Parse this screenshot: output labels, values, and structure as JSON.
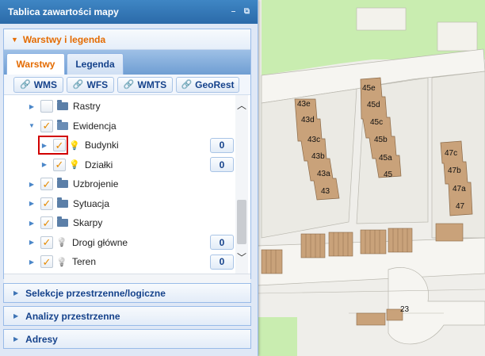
{
  "panel": {
    "title": "Tablica zawartości mapy",
    "tools": {
      "minimize": "–",
      "popout": "⧉"
    }
  },
  "layers_section": {
    "title": "Warstwy i legenda",
    "tabs": [
      {
        "label": "Warstwy",
        "active": true
      },
      {
        "label": "Legenda",
        "active": false
      }
    ],
    "services": [
      "WMS",
      "WFS",
      "WMTS",
      "GeoRest"
    ]
  },
  "tree": [
    {
      "label": "Rastry",
      "checked": false,
      "icon": "folder-icon",
      "expanded": false,
      "level": 0,
      "count": null
    },
    {
      "label": "Ewidencja",
      "checked": true,
      "icon": "folder-open-icon",
      "expanded": true,
      "level": 0,
      "count": null
    },
    {
      "label": "Budynki",
      "checked": true,
      "icon": "lightbulb-icon",
      "expanded": false,
      "level": 1,
      "count": "0",
      "highlighted": true
    },
    {
      "label": "Działki",
      "checked": true,
      "icon": "lightbulb-icon",
      "expanded": false,
      "level": 1,
      "count": "0"
    },
    {
      "label": "Uzbrojenie",
      "checked": true,
      "icon": "folder-icon",
      "expanded": false,
      "level": 0,
      "count": null
    },
    {
      "label": "Sytuacja",
      "checked": true,
      "icon": "folder-icon",
      "expanded": false,
      "level": 0,
      "count": null
    },
    {
      "label": "Skarpy",
      "checked": true,
      "icon": "folder-icon",
      "expanded": false,
      "level": 0,
      "count": null
    },
    {
      "label": "Drogi główne",
      "checked": true,
      "icon": "lightbulb-grey-icon",
      "expanded": false,
      "level": 0,
      "count": "0"
    },
    {
      "label": "Teren",
      "checked": true,
      "icon": "lightbulb-grey-icon",
      "expanded": false,
      "level": 0,
      "count": "0"
    }
  ],
  "collapsed_sections": [
    "Selekcje przestrzenne/logiczne",
    "Analizy przestrzenne",
    "Adresy"
  ],
  "map": {
    "building_labels_left": [
      "43e",
      "43d",
      "43c",
      "43b",
      "43a",
      "43"
    ],
    "building_labels_mid": [
      "45e",
      "45d",
      "45c",
      "45b",
      "45a",
      "45"
    ],
    "building_labels_right": [
      "47c",
      "47b",
      "47a",
      "47"
    ],
    "building_label_bottom": "23",
    "colors": {
      "building": "#c9a27a",
      "green": "#c9edb0",
      "road": "#f6f5f1",
      "ground": "#e8e7e1"
    }
  }
}
